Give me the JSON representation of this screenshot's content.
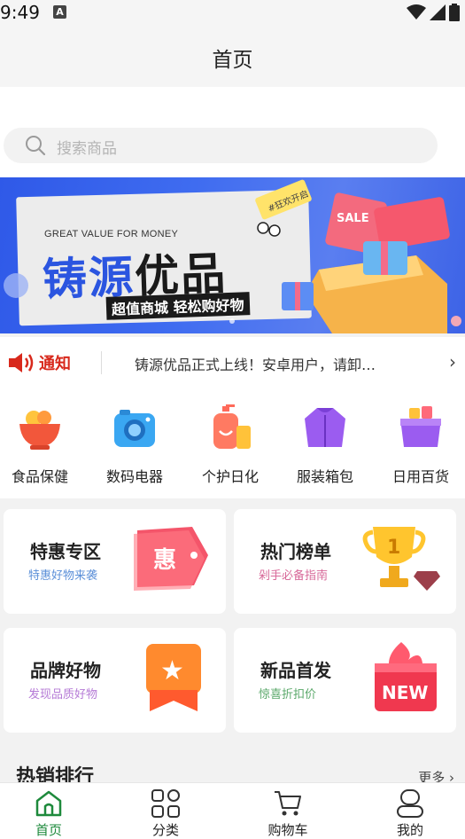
{
  "status_bar": {
    "time": "9:49",
    "notification_letter": "A"
  },
  "header": {
    "title": "首页"
  },
  "search": {
    "placeholder": "搜索商品"
  },
  "banner": {
    "subtitle": "GREAT VALUE FOR MONEY",
    "title_part1": "铸源",
    "title_part2": "优品",
    "slogan": "超值商城 轻松购好物",
    "tag": "#狂欢开启"
  },
  "notice": {
    "label": "通知",
    "text": "铸源优品正式上线！安卓用户，请卸…",
    "arrow": "›"
  },
  "categories": [
    {
      "label": "食品保健",
      "icon": "food-bowl-icon"
    },
    {
      "label": "数码电器",
      "icon": "camera-icon"
    },
    {
      "label": "个护日化",
      "icon": "cosmetics-icon"
    },
    {
      "label": "服装箱包",
      "icon": "jacket-icon"
    },
    {
      "label": "日用百货",
      "icon": "basket-icon"
    }
  ],
  "promos": [
    {
      "title": "特惠专区",
      "subtitle": "特惠好物来袭",
      "subtitle_color": "#5b8fd8",
      "badge": "惠"
    },
    {
      "title": "热门榜单",
      "subtitle": "剁手必备指南",
      "subtitle_color": "#d86a9a",
      "badge": "1"
    },
    {
      "title": "品牌好物",
      "subtitle": "发现品质好物",
      "subtitle_color": "#b57ad6",
      "badge": "★"
    },
    {
      "title": "新品首发",
      "subtitle": "惊喜折扣价",
      "subtitle_color": "#5aa86a",
      "badge": "NEW"
    }
  ],
  "hot_section": {
    "title": "热销排行",
    "more": "更多 ›"
  },
  "tabbar": [
    {
      "label": "首页",
      "active": true
    },
    {
      "label": "分类",
      "active": false
    },
    {
      "label": "购物车",
      "active": false
    },
    {
      "label": "我的",
      "active": false
    }
  ],
  "colors": {
    "accent": "#1e8a3c",
    "notice_red": "#d8291c",
    "banner_blue": "#2f59e8"
  }
}
